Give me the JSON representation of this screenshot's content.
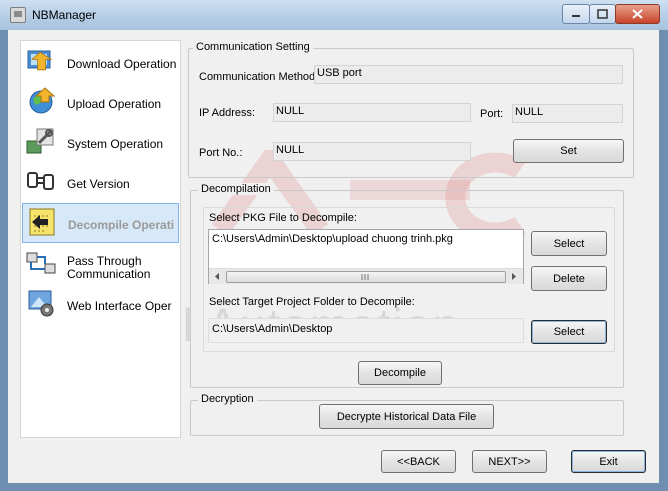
{
  "window": {
    "title": "NBManager"
  },
  "sidebar": {
    "items": [
      {
        "label": "Download Operation"
      },
      {
        "label": "Upload Operation"
      },
      {
        "label": "System Operation"
      },
      {
        "label": "Get Version"
      },
      {
        "label": "Decompile Operati"
      },
      {
        "label": "Pass Through\nCommunication"
      },
      {
        "label": "Web Interface Oper"
      }
    ]
  },
  "communication": {
    "title": "Communication Setting",
    "method_label": "Communication Method:",
    "method_value": "USB port",
    "ip_label": "IP Address:",
    "ip_value": "NULL",
    "port_label": "Port:",
    "port_value": "NULL",
    "portno_label": "Port No.:",
    "portno_value": "NULL",
    "set_label": "Set"
  },
  "decompilation": {
    "title": "Decompilation",
    "pkg_label": "Select PKG File to Decompile:",
    "pkg_path": "C:\\Users\\Admin\\Desktop\\upload chuong trinh.pkg",
    "select_label": "Select",
    "delete_label": "Delete",
    "folder_label": "Select Target Project Folder to Decompile:",
    "folder_path": "C:\\Users\\Admin\\Desktop",
    "select2_label": "Select",
    "decompile_label": "Decompile"
  },
  "decryption": {
    "title": "Decryption",
    "button_label": "Decrypte Historical Data File"
  },
  "footer": {
    "back_label": "<<BACK",
    "next_label": "NEXT>>",
    "exit_label": "Exit"
  },
  "watermark": {
    "text": "Global Automation"
  }
}
